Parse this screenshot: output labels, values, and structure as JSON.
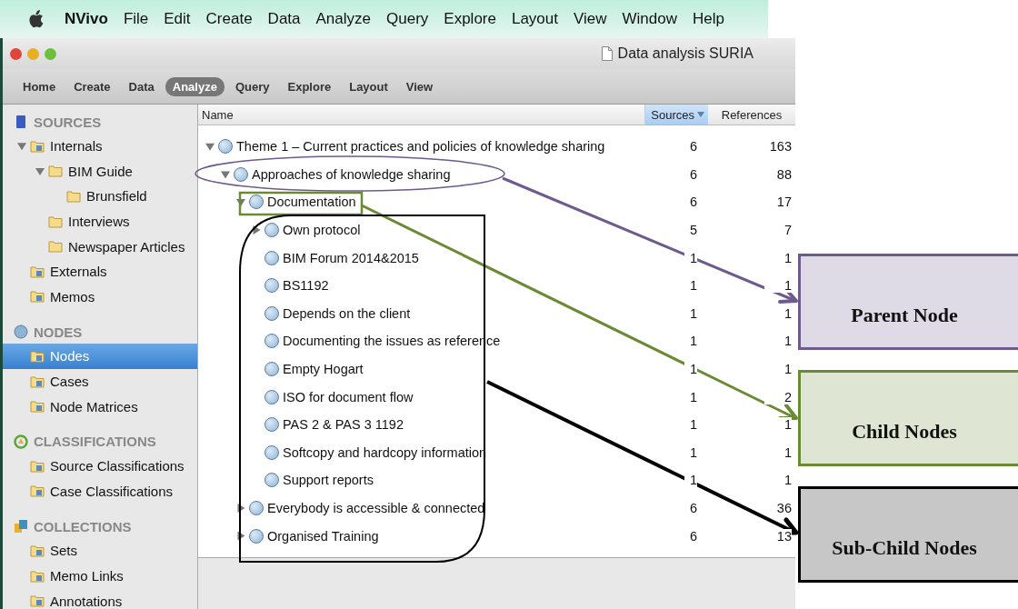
{
  "menu_bar": {
    "app": "NVivo",
    "items": [
      "File",
      "Edit",
      "Create",
      "Data",
      "Analyze",
      "Query",
      "Explore",
      "Layout",
      "View",
      "Window",
      "Help"
    ]
  },
  "window": {
    "title": "Data analysis SURIA"
  },
  "ribbon_tabs": [
    {
      "label": "Home",
      "selected": false
    },
    {
      "label": "Create",
      "selected": false
    },
    {
      "label": "Data",
      "selected": false
    },
    {
      "label": "Analyze",
      "selected": true
    },
    {
      "label": "Query",
      "selected": false
    },
    {
      "label": "Explore",
      "selected": false
    },
    {
      "label": "Layout",
      "selected": false
    },
    {
      "label": "View",
      "selected": false
    }
  ],
  "sidebar": [
    {
      "title": "SOURCES",
      "kind": "sources",
      "items": [
        {
          "label": "Internals",
          "kind": "special",
          "selected": false,
          "expanded": true,
          "children": [
            {
              "label": "BIM Guide",
              "kind": "folder",
              "selected": false,
              "expanded": true,
              "children": [
                {
                  "label": "Brunsfield",
                  "kind": "folder",
                  "selected": false
                }
              ]
            },
            {
              "label": "Interviews",
              "kind": "folder",
              "selected": false
            },
            {
              "label": "Newspaper Articles",
              "kind": "folder",
              "selected": false
            }
          ]
        },
        {
          "label": "Externals",
          "kind": "special",
          "selected": false
        },
        {
          "label": "Memos",
          "kind": "special",
          "selected": false
        }
      ]
    },
    {
      "title": "NODES",
      "kind": "nodes",
      "items": [
        {
          "label": "Nodes",
          "kind": "special",
          "selected": true
        },
        {
          "label": "Cases",
          "kind": "special",
          "selected": false
        },
        {
          "label": "Node Matrices",
          "kind": "special",
          "selected": false
        }
      ]
    },
    {
      "title": "CLASSIFICATIONS",
      "kind": "classifications",
      "items": [
        {
          "label": "Source Classifications",
          "kind": "special",
          "selected": false
        },
        {
          "label": "Case Classifications",
          "kind": "special",
          "selected": false
        }
      ]
    },
    {
      "title": "COLLECTIONS",
      "kind": "collections",
      "items": [
        {
          "label": "Sets",
          "kind": "special",
          "selected": false
        },
        {
          "label": "Memo Links",
          "kind": "special",
          "selected": false
        },
        {
          "label": "Annotations",
          "kind": "special",
          "selected": false
        }
      ]
    }
  ],
  "table": {
    "columns": [
      {
        "label": "Name",
        "sorted": false
      },
      {
        "label": "Sources",
        "sorted": true
      },
      {
        "label": "References",
        "sorted": false
      }
    ],
    "rows": [
      {
        "name": "Theme 1 – Current practices and policies of knowledge sharing",
        "sources": "6",
        "references": "163",
        "expanded": true,
        "children": [
          {
            "name": "Approaches of knowledge sharing",
            "sources": "6",
            "references": "88",
            "expanded": true,
            "children": [
              {
                "name": "Documentation",
                "sources": "6",
                "references": "17",
                "expanded": true,
                "children": [
                  {
                    "name": "Own protocol",
                    "sources": "5",
                    "references": "7",
                    "expanded": false
                  },
                  {
                    "name": "BIM Forum 2014&2015",
                    "sources": "1",
                    "references": "1"
                  },
                  {
                    "name": "BS1192",
                    "sources": "1",
                    "references": "1"
                  },
                  {
                    "name": "Depends on the client",
                    "sources": "1",
                    "references": "1"
                  },
                  {
                    "name": "Documenting the issues as reference",
                    "sources": "1",
                    "references": "1"
                  },
                  {
                    "name": "Empty Hogart",
                    "sources": "1",
                    "references": "1"
                  },
                  {
                    "name": "ISO for document flow",
                    "sources": "1",
                    "references": "2"
                  },
                  {
                    "name": "PAS 2 & PAS 3 1192",
                    "sources": "1",
                    "references": "1"
                  },
                  {
                    "name": "Softcopy and hardcopy information",
                    "sources": "1",
                    "references": "1"
                  },
                  {
                    "name": "Support reports",
                    "sources": "1",
                    "references": "1"
                  }
                ]
              },
              {
                "name": "Everybody is accessible & connected",
                "sources": "6",
                "references": "36",
                "expanded": false
              },
              {
                "name": "Organised Training",
                "sources": "6",
                "references": "13",
                "expanded": false
              }
            ]
          }
        ]
      }
    ]
  },
  "callouts": [
    {
      "label": "Parent Node",
      "kind": "ellipse",
      "color": "#6e5a8c"
    },
    {
      "label": "Child Nodes",
      "kind": "rectangle",
      "color": "#6b8a34"
    },
    {
      "label": "Sub-Child Nodes",
      "kind": "frame",
      "color": "#000000"
    }
  ]
}
